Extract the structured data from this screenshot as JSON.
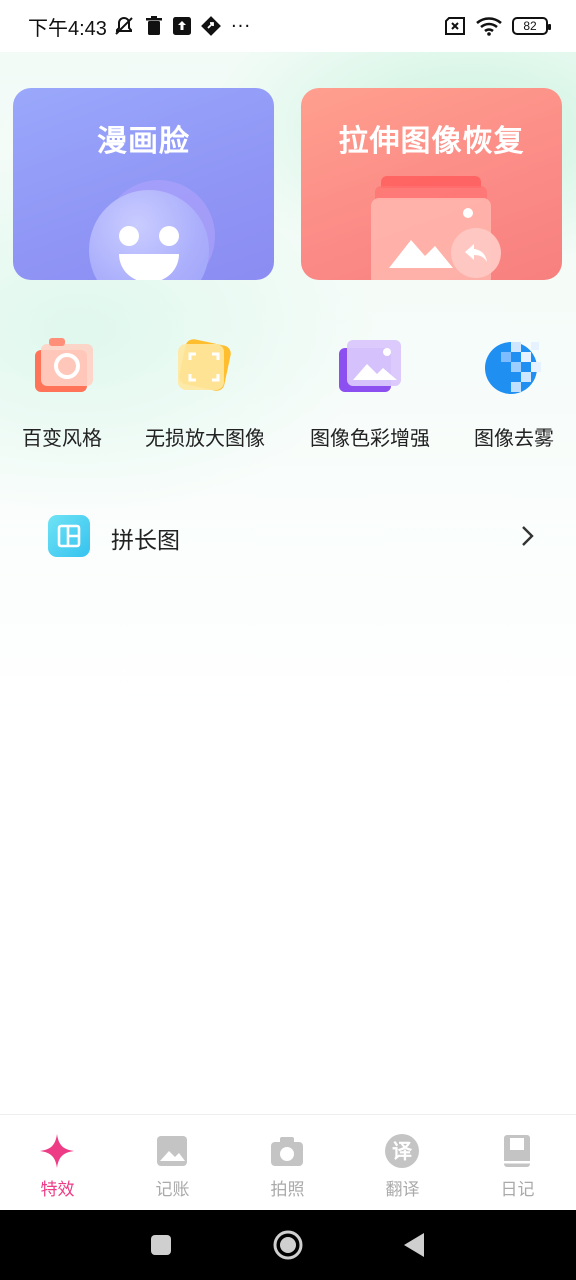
{
  "status_bar": {
    "time": "下午4:43",
    "more": "···",
    "battery": "82"
  },
  "cards": [
    {
      "title": "漫画脸"
    },
    {
      "title": "拉伸图像恢复"
    }
  ],
  "tools": [
    {
      "label": "百变风格"
    },
    {
      "label": "无损放大图像"
    },
    {
      "label": "图像色彩增强"
    },
    {
      "label": "图像去雾"
    }
  ],
  "list": {
    "item_label": "拼长图"
  },
  "bottom_nav": [
    {
      "label": "特效",
      "active": true
    },
    {
      "label": "记账"
    },
    {
      "label": "拍照"
    },
    {
      "label": "翻译",
      "icon_text": "译"
    },
    {
      "label": "日记"
    }
  ],
  "colors": {
    "accent": "#ee3b86",
    "card_left": "#9aa8fb",
    "card_right": "#ff9f8e"
  }
}
